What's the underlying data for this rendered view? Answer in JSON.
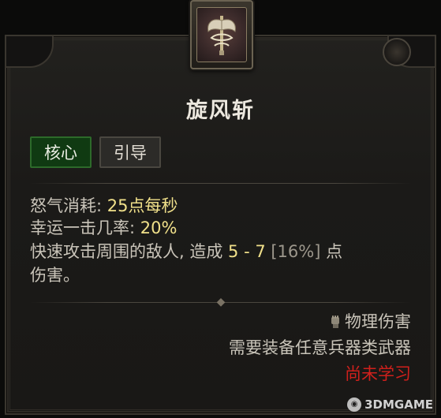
{
  "skill": {
    "title": "旋风斩",
    "icon": "whirlwind-axe-icon",
    "tags": [
      "核心",
      "引导"
    ]
  },
  "stats": {
    "fury_label": "怒气消耗: ",
    "fury_value": "25点每秒",
    "lucky_label": "幸运一击几率: ",
    "lucky_value": "20%",
    "desc_prefix": "快速攻击周围的敌人, 造成 ",
    "desc_damage": "5 - 7",
    "desc_percent": " [16%]",
    "desc_suffix": " 点",
    "desc_line2": "伤害。"
  },
  "footer": {
    "damage_type_icon": "fist-icon",
    "damage_type": "物理伤害",
    "requirement": "需要装备任意兵器类武器",
    "status": "尚未学习"
  },
  "watermark": {
    "text": "3DMGAME"
  },
  "colors": {
    "core_tag_bg": "#103a12",
    "value_yellow": "#f0e08a",
    "not_learned_red": "#d0201c"
  }
}
